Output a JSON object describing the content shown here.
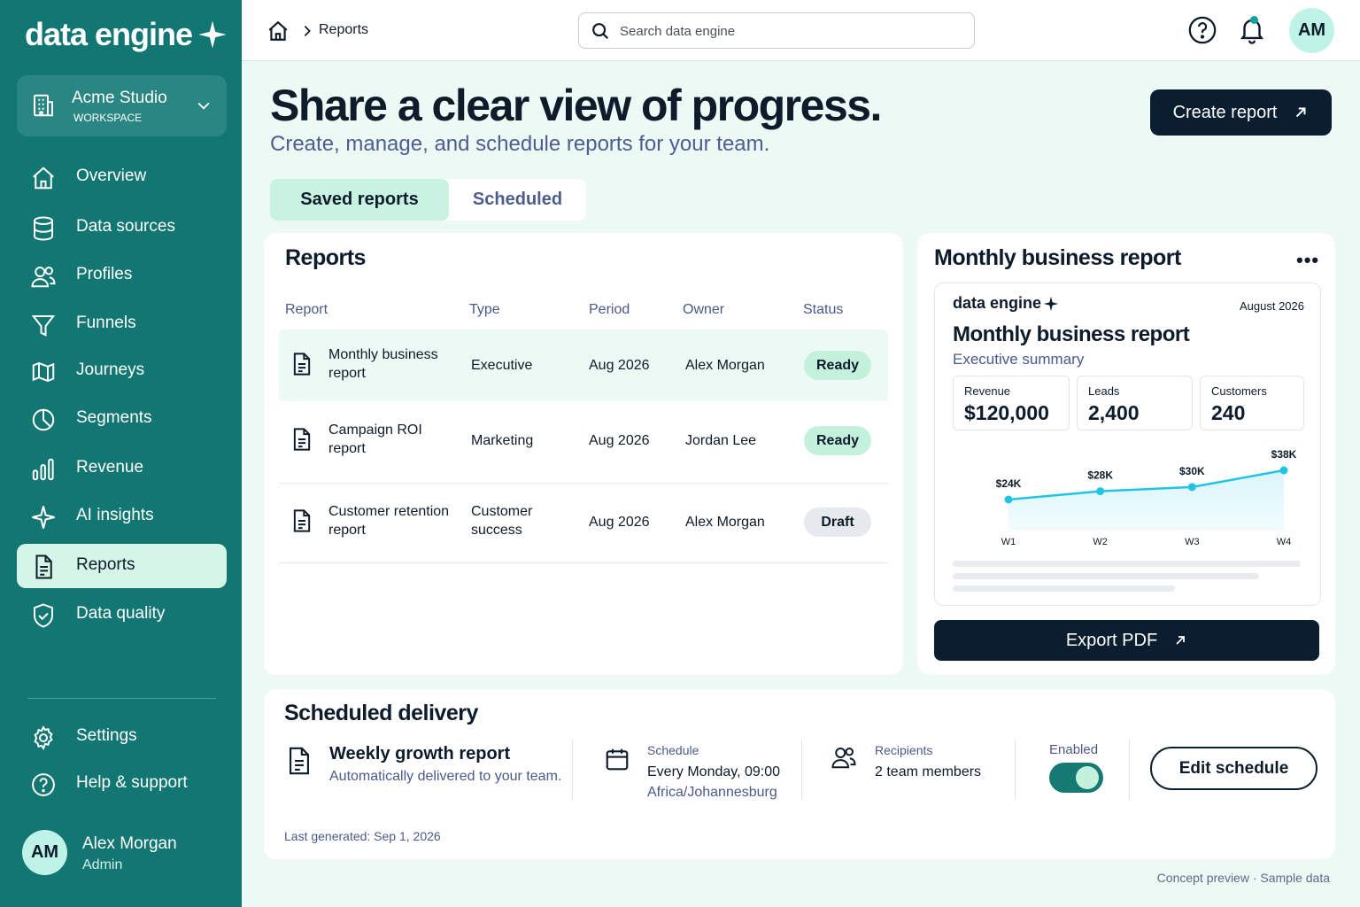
{
  "sidebar": {
    "logo": "data engine",
    "workspace": {
      "name": "Acme Studio",
      "label": "WORKSPACE"
    },
    "nav": [
      {
        "label": "Overview",
        "icon": "home-icon"
      },
      {
        "label": "Data sources",
        "icon": "database-icon"
      },
      {
        "label": "Profiles",
        "icon": "users-icon"
      },
      {
        "label": "Funnels",
        "icon": "funnel-icon"
      },
      {
        "label": "Journeys",
        "icon": "journey-icon"
      },
      {
        "label": "Segments",
        "icon": "pie-icon"
      },
      {
        "label": "Revenue",
        "icon": "bar-chart-icon"
      },
      {
        "label": "AI insights",
        "icon": "sparkle-icon"
      },
      {
        "label": "Reports",
        "icon": "document-icon",
        "active": true
      },
      {
        "label": "Data quality",
        "icon": "shield-check-icon"
      }
    ],
    "bottom": [
      {
        "label": "Settings",
        "icon": "gear-icon"
      },
      {
        "label": "Help & support",
        "icon": "help-icon"
      }
    ],
    "user": {
      "initials": "AM",
      "name": "Alex Morgan",
      "role": "Admin"
    }
  },
  "topbar": {
    "breadcrumb": "Reports",
    "search_placeholder": "Search data engine",
    "avatar_initials": "AM"
  },
  "header": {
    "title": "Share a clear view of progress.",
    "subtitle": "Create, manage, and schedule reports for your team.",
    "create_button": "Create report"
  },
  "tabs": [
    {
      "label": "Saved reports",
      "active": true
    },
    {
      "label": "Scheduled",
      "active": false
    }
  ],
  "reports": {
    "title": "Reports",
    "columns": [
      "Report",
      "Type",
      "Period",
      "Owner",
      "Status"
    ],
    "rows": [
      {
        "name": "Monthly business report",
        "type": "Executive",
        "period": "Aug 2026",
        "owner": "Alex Morgan",
        "status": "Ready"
      },
      {
        "name": "Campaign ROI report",
        "type": "Marketing",
        "period": "Aug 2026",
        "owner": "Jordan Lee",
        "status": "Ready"
      },
      {
        "name": "Customer retention report",
        "type": "Customer success",
        "period": "Aug 2026",
        "owner": "Alex Morgan",
        "status": "Draft"
      }
    ]
  },
  "preview": {
    "title": "Monthly business report",
    "brand": "data engine",
    "date": "August 2026",
    "report_title": "Monthly business report",
    "report_subtitle": "Executive summary",
    "metrics": [
      {
        "label": "Revenue",
        "value": "$120,000"
      },
      {
        "label": "Leads",
        "value": "2,400"
      },
      {
        "label": "Customers",
        "value": "240"
      }
    ],
    "export_button": "Export PDF"
  },
  "chart_data": {
    "type": "area",
    "x": [
      "W1",
      "W2",
      "W3",
      "W4"
    ],
    "values": [
      24,
      28,
      30,
      38
    ],
    "labels": [
      "$24K",
      "$28K",
      "$30K",
      "$38K"
    ],
    "xlabel": "",
    "ylabel": "",
    "grid": false,
    "colors": {
      "line": "#22c4e6",
      "fill": "#d9f6fb"
    }
  },
  "scheduled": {
    "title": "Scheduled delivery",
    "report_name": "Weekly growth report",
    "report_desc": "Automatically delivered to your team.",
    "schedule_label": "Schedule",
    "schedule_value": "Every Monday, 09:00",
    "timezone": "Africa/Johannesburg",
    "recipients_label": "Recipients",
    "recipients_value": "2 team members",
    "enabled_label": "Enabled",
    "enabled": true,
    "edit_button": "Edit schedule",
    "last_generated": "Last generated: Sep 1, 2026"
  },
  "footer": "Concept preview · Sample data",
  "colors": {
    "sidebar": "#127672",
    "accent": "#c4f1dc",
    "dark": "#0b1e30",
    "background": "#edf9f4"
  }
}
